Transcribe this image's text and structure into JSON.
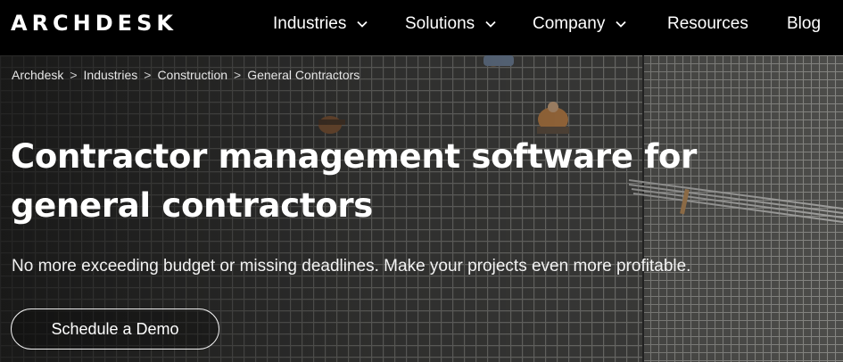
{
  "brand": {
    "logo_text": "ARCHDESK"
  },
  "nav": {
    "items": [
      {
        "label": "Industries",
        "has_dropdown": true
      },
      {
        "label": "Solutions",
        "has_dropdown": true
      },
      {
        "label": "Company",
        "has_dropdown": true
      },
      {
        "label": "Resources",
        "has_dropdown": false
      },
      {
        "label": "Blog",
        "has_dropdown": false
      }
    ]
  },
  "breadcrumb": [
    "Archdesk",
    "Industries",
    "Construction",
    "General Contractors"
  ],
  "breadcrumb_separator": ">",
  "hero": {
    "title": "Contractor management software for general contractors",
    "subtitle": "No more exceeding budget or missing deadlines. Make your projects even more profitable.",
    "cta_label": "Schedule a Demo"
  },
  "colors": {
    "background": "#000000",
    "text": "#ffffff",
    "hero_photo_tone": "#4a4a48"
  },
  "icons": {
    "dropdown": "chevron-down-icon"
  }
}
